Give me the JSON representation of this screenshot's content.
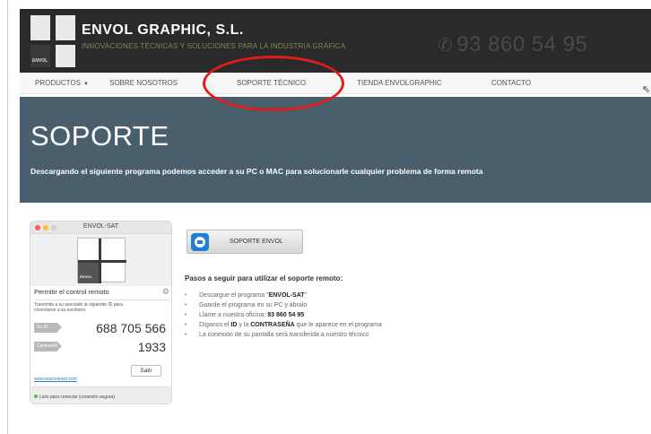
{
  "header": {
    "company": "ENVOL GRAPHIC, S.L.",
    "tagline": "INNOVACIONES TÉCNICAS Y SOLUCIONES PARA LA INDUSTRIA GRÁFICA",
    "phone": "93 860 54 95",
    "logo_text": "ENVOL",
    "logo_vertical": "GRAPHIC"
  },
  "nav": {
    "items": [
      "PRODUCTOS",
      "SOBRE NOSOTROS",
      "SOPORTE TÉCNICO",
      "TIENDA ENVOLGRAPHIC",
      "CONTACTO"
    ]
  },
  "hero": {
    "title": "SOPORTE",
    "subtitle": "Descargando el siguiente programa podemos acceder a su PC o MAC para solucionarle cualquier problema de forma remota"
  },
  "teamviewer": {
    "window_title": "ENVOL-SAT",
    "allow_label": "Permitir el control remoto",
    "instructions": "Transmita a su asociado la siguiente ID para conectarse a su escritorio:",
    "id_label": "Su ID",
    "id_value": "688 705 566",
    "password_label": "Contraseña",
    "password_value": "1933",
    "link_text": "www.teamviewer.com",
    "exit_label": "Salir",
    "status": "Listo para conectar (conexión segura)"
  },
  "support_button": {
    "label": "SOPORTE ENVOL"
  },
  "steps": {
    "title": "Pasos a seguir para utilizar el soporte remoto:",
    "items": [
      {
        "pre": "Descargue el programa \"",
        "bold": "ENVOL-SAT",
        "post": "\""
      },
      {
        "pre": "Guarde el programa en su PC y ábralo",
        "bold": "",
        "post": ""
      },
      {
        "pre": "Llame a nuestra oficina: ",
        "bold": "93 860 54 95",
        "post": ""
      },
      {
        "pre": "Díganos el ",
        "bold": "ID",
        "mid": " y la ",
        "bold2": "CONTRASEÑA",
        "post": " que le aparece en el programa"
      },
      {
        "pre": "La conexión de su pantalla será transferida a nuestro técnico",
        "bold": "",
        "post": ""
      }
    ]
  },
  "colors": {
    "header_bg": "#2a2a2a",
    "hero_bg": "#4a5f6e",
    "annotation": "#e21b1b",
    "teamviewer_blue": "#1f7fd6"
  }
}
